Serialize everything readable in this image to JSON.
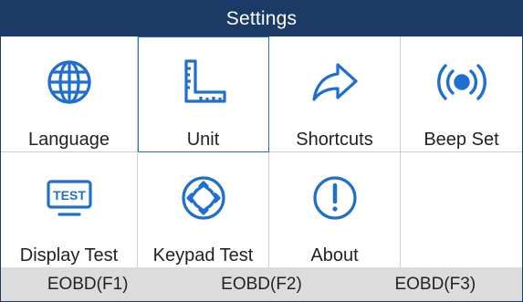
{
  "title": "Settings",
  "accent_color": "#1e6fd0",
  "tiles": [
    {
      "label": "Language",
      "icon": "globe-icon"
    },
    {
      "label": "Unit",
      "icon": "ruler-icon",
      "selected": true
    },
    {
      "label": "Shortcuts",
      "icon": "share-arrow-icon"
    },
    {
      "label": "Beep Set",
      "icon": "broadcast-icon"
    },
    {
      "label": "Display Test",
      "icon": "test-monitor-icon"
    },
    {
      "label": "Keypad Test",
      "icon": "keypad-diamond-icon"
    },
    {
      "label": "About",
      "icon": "info-exclamation-icon"
    }
  ],
  "function_keys": [
    {
      "label": "EOBD(F1)"
    },
    {
      "label": "EOBD(F2)"
    },
    {
      "label": "EOBD(F3)"
    }
  ],
  "test_icon_text": "TEST"
}
